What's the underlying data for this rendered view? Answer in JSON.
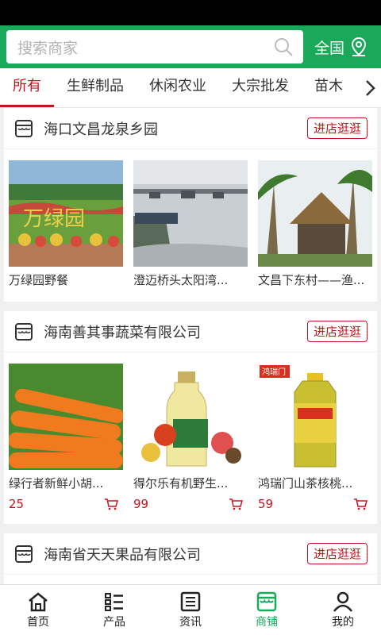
{
  "search": {
    "placeholder": "搜索商家"
  },
  "region": {
    "label": "全国"
  },
  "tabs": [
    {
      "label": "所有",
      "active": true
    },
    {
      "label": "生鲜制品"
    },
    {
      "label": "休闲农业"
    },
    {
      "label": "大宗批发"
    },
    {
      "label": "苗木"
    }
  ],
  "shops": [
    {
      "name": "海口文昌龙泉乡园",
      "enter_label": "进店逛逛",
      "products": [
        {
          "title": "万绿园野餐",
          "image": "万绿园"
        },
        {
          "title": "澄迈桥头太阳湾...",
          "image": ""
        },
        {
          "title": "文昌下东村——渔...",
          "image": ""
        }
      ]
    },
    {
      "name": "海南善其事蔬菜有限公司",
      "enter_label": "进店逛逛",
      "products": [
        {
          "title": "绿行者新鲜小胡...",
          "price": "25"
        },
        {
          "title": "得尔乐有机野生...",
          "price": "99"
        },
        {
          "title": "鸿瑞门山茶核桃...",
          "price": "59",
          "brand": "鸿瑞门"
        }
      ]
    },
    {
      "name": "海南省天天果品有限公司",
      "enter_label": "进店逛逛"
    }
  ],
  "nav": [
    {
      "label": "首页",
      "icon": "home-icon"
    },
    {
      "label": "产品",
      "icon": "list-icon"
    },
    {
      "label": "资讯",
      "icon": "news-icon"
    },
    {
      "label": "商铺",
      "icon": "store-icon",
      "active": true
    },
    {
      "label": "我的",
      "icon": "user-icon"
    }
  ],
  "colors": {
    "brand_green": "#1aa85a",
    "accent_red": "#c8141e"
  }
}
